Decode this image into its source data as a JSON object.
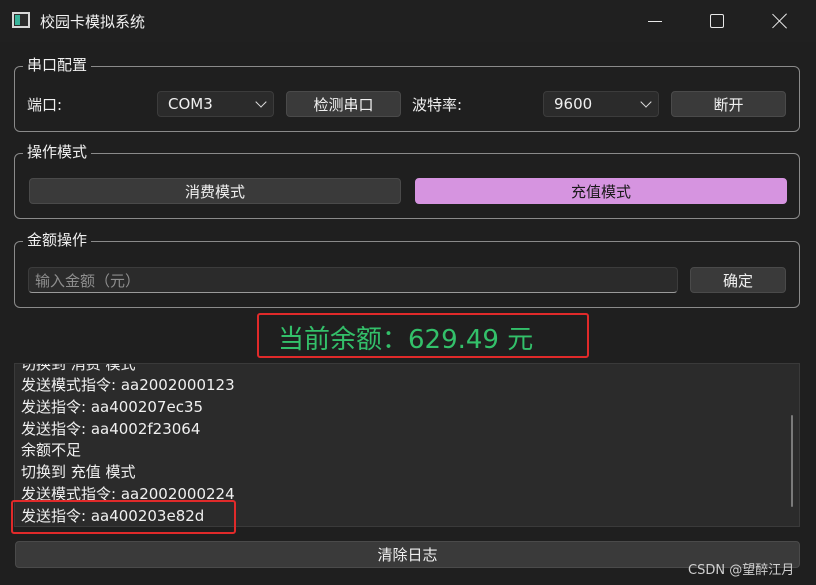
{
  "window": {
    "title": "校园卡模拟系统"
  },
  "serial": {
    "group_title": "串口配置",
    "port_label": "端口:",
    "port_value": "COM3",
    "detect_button": "检测串口",
    "baud_label": "波特率:",
    "baud_value": "9600",
    "disconnect_button": "断开"
  },
  "mode": {
    "group_title": "操作模式",
    "consume_button": "消费模式",
    "recharge_button": "充值模式",
    "active": "recharge",
    "active_color": "#d694e0"
  },
  "amount": {
    "group_title": "金额操作",
    "placeholder": "输入金额（元）",
    "confirm_button": "确定"
  },
  "balance": {
    "text": "当前余额：629.49 元",
    "color": "#33c06a"
  },
  "log": {
    "lines": [
      "切换到 消费 模式",
      "发送模式指令: aa2002000123",
      "发送指令: aa400207ec35",
      "发送指令: aa4002f23064",
      "余额不足",
      "切换到 充值 模式",
      "发送模式指令: aa2002000224",
      "发送指令: aa400203e82d"
    ]
  },
  "clear_log_button": "清除日志",
  "watermark": "CSDN @望醉江月"
}
